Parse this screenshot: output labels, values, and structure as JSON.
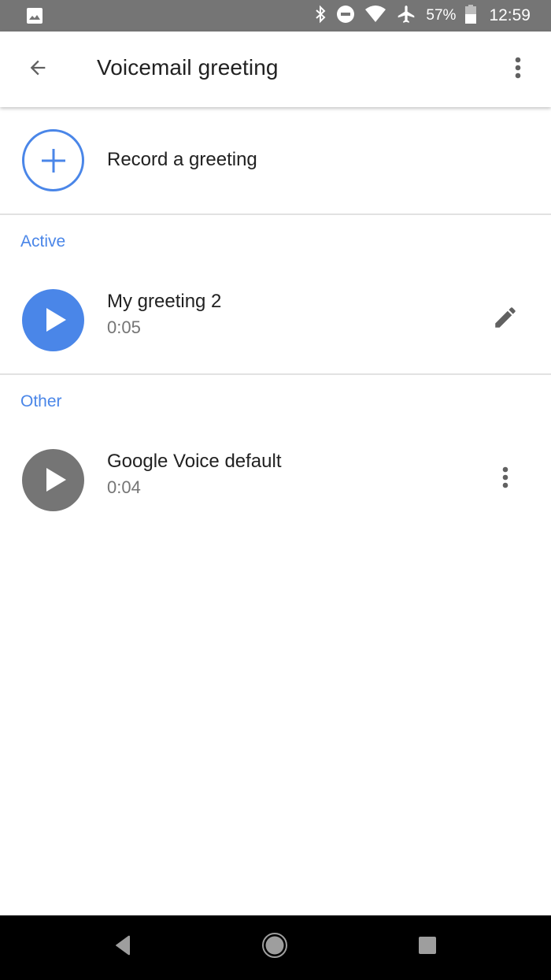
{
  "status_bar": {
    "left_icon": "image-notification-icon",
    "icons": [
      "bluetooth-icon",
      "do-not-disturb-icon",
      "wifi-icon",
      "airplane-mode-icon",
      "battery-icon"
    ],
    "battery_percent": "57%",
    "clock": "12:59"
  },
  "app_bar": {
    "back_icon": "arrow-back-icon",
    "title": "Voicemail greeting",
    "overflow_icon": "more-vert-icon"
  },
  "record": {
    "icon": "add-circle-outline-icon",
    "label": "Record a greeting"
  },
  "sections": [
    {
      "header": "Active",
      "items": [
        {
          "name": "My greeting 2",
          "duration": "0:05",
          "play_icon": "play-icon",
          "action_icon": "edit-pencil-icon",
          "color": "#4a86e8"
        }
      ]
    },
    {
      "header": "Other",
      "items": [
        {
          "name": "Google Voice default",
          "duration": "0:04",
          "play_icon": "play-icon",
          "action_icon": "more-vert-icon",
          "color": "#757575"
        }
      ]
    }
  ],
  "nav_bar": {
    "buttons": [
      "back-triangle-icon",
      "home-circle-icon",
      "recents-square-icon"
    ]
  },
  "colors": {
    "accent": "#4a86e8",
    "status_bar": "#757575",
    "inactive": "#757575",
    "text_primary": "#212121",
    "text_secondary": "#757575"
  }
}
